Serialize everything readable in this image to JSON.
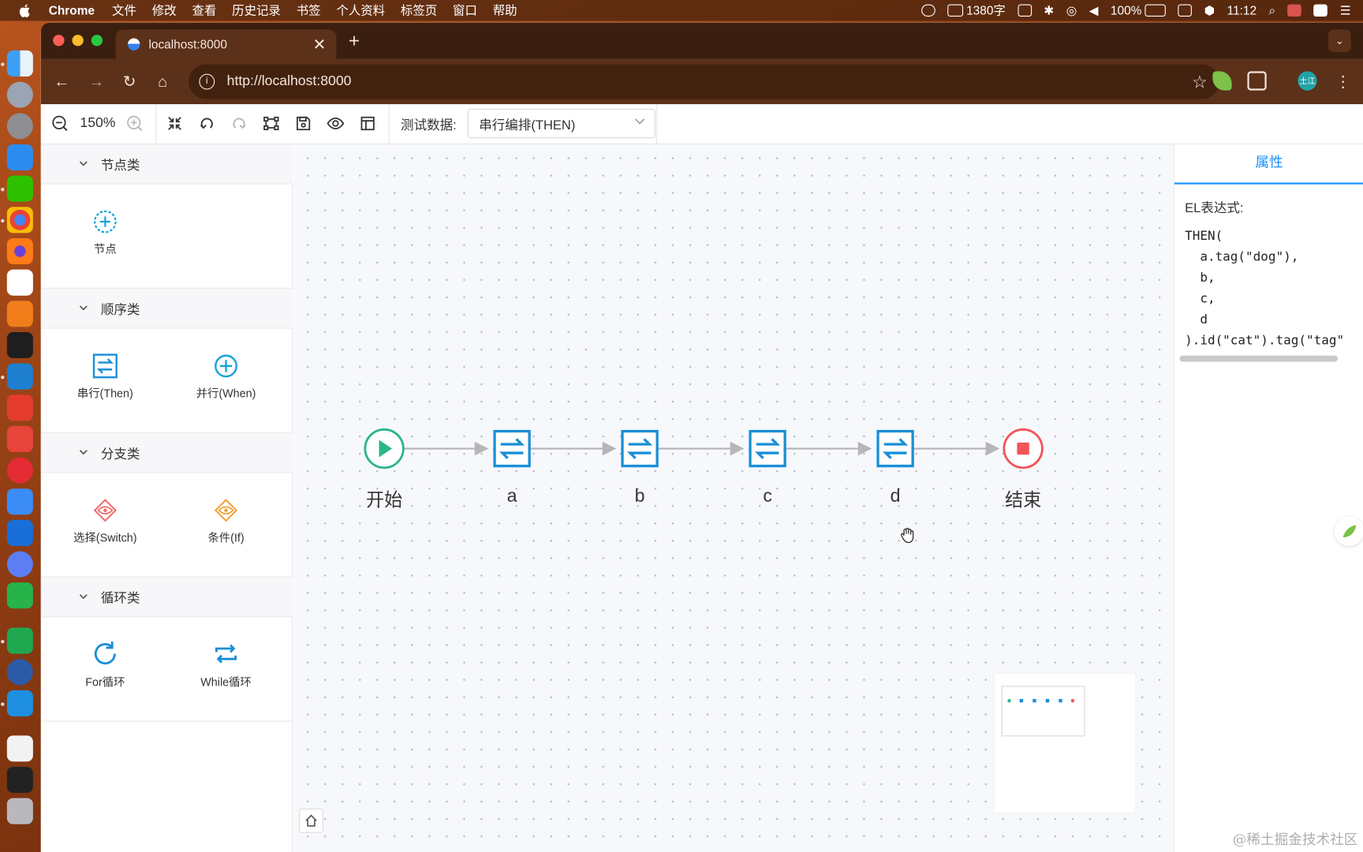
{
  "menubar": {
    "app": "Chrome",
    "items": [
      "文件",
      "修改",
      "查看",
      "历史记录",
      "书签",
      "个人资料",
      "标签页",
      "窗口",
      "帮助"
    ],
    "status": {
      "wordcount": "1380字",
      "battery": "100%",
      "time": "11:12"
    }
  },
  "browser": {
    "tab_title": "localhost:8000",
    "url": "http://localhost:8000",
    "profile_badge": "土江"
  },
  "editor_toolbar": {
    "zoom": "150%",
    "data_label": "测试数据:",
    "data_value": "串行编排(THEN)"
  },
  "sidebar": {
    "groups": [
      {
        "title": "节点类",
        "items": [
          {
            "label": "节点",
            "icon": "plus-circle-icon"
          }
        ]
      },
      {
        "title": "顺序类",
        "items": [
          {
            "label": "串行(Then)",
            "icon": "serial-icon"
          },
          {
            "label": "并行(When)",
            "icon": "plus-circle-icon"
          }
        ]
      },
      {
        "title": "分支类",
        "items": [
          {
            "label": "选择(Switch)",
            "icon": "diamond-eye-icon"
          },
          {
            "label": "条件(If)",
            "icon": "diamond-eye-icon"
          }
        ]
      },
      {
        "title": "循环类",
        "items": [
          {
            "label": "For循环",
            "icon": "refresh-icon"
          },
          {
            "label": "While循环",
            "icon": "loop-icon"
          }
        ]
      }
    ]
  },
  "flow": {
    "nodes": [
      {
        "label": "开始",
        "type": "start"
      },
      {
        "label": "a",
        "type": "then"
      },
      {
        "label": "b",
        "type": "then"
      },
      {
        "label": "c",
        "type": "then"
      },
      {
        "label": "d",
        "type": "then"
      },
      {
        "label": "结束",
        "type": "end"
      }
    ]
  },
  "properties": {
    "tab": "属性",
    "el_label": "EL表达式:",
    "el_code": "THEN(\n  a.tag(\"dog\"),\n  b,\n  c,\n  d\n).id(\"cat\").tag(\"tag\""
  },
  "watermark": "@稀土掘金技术社区",
  "colors": {
    "accent": "#1890ff",
    "start": "#2bb58a",
    "end": "#f0555a",
    "then": "#1a8fd8",
    "switch": "#f06a6a",
    "if": "#f0a030"
  }
}
